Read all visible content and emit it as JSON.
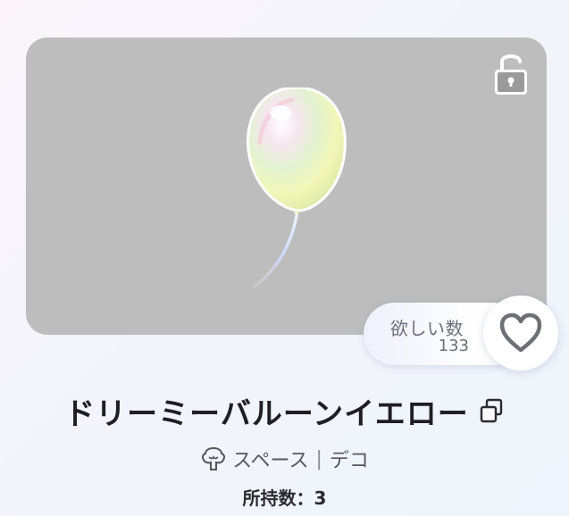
{
  "item": {
    "title": "ドリーミーバルーンイエロー",
    "category": "スペース",
    "subcategory": "デコ",
    "category_separator": "|",
    "owned_label": "所持数：3"
  },
  "wishlist": {
    "label": "欲しい数",
    "count": "133"
  },
  "icons": {
    "lock": "unlocked-lock-icon",
    "heart": "heart-outline-icon",
    "copy": "copy-icon",
    "category": "tree-icon"
  },
  "colors": {
    "card_background": "#bdbdbd",
    "title_text": "#1e1e24",
    "wish_text": "#6c6f7a"
  }
}
